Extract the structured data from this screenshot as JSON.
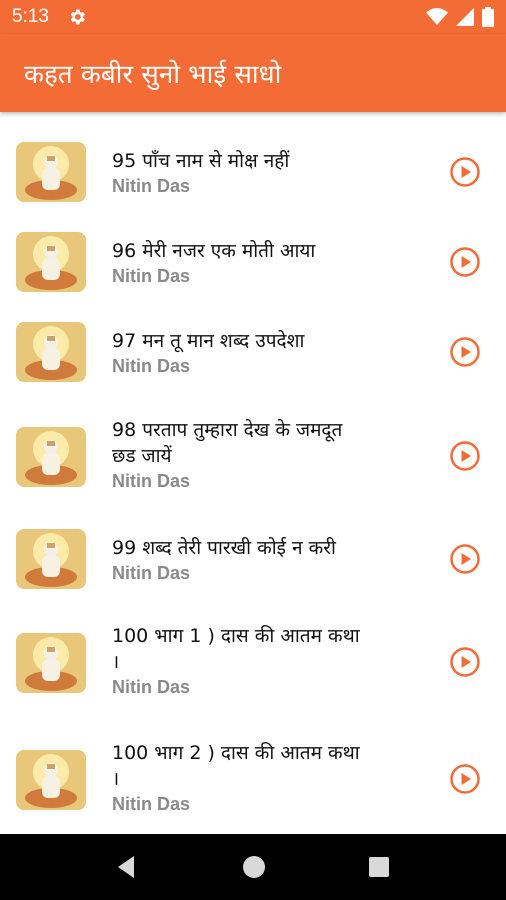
{
  "status_bar": {
    "time": "5:13",
    "icons": [
      "gear-icon",
      "wifi-icon",
      "cellular-icon",
      "battery-icon"
    ]
  },
  "app_bar": {
    "title": "कहत कबीर सुनो भाई साधो",
    "color": "#f36b35"
  },
  "songs": [
    {
      "title_lines": [
        "95 पाँच नाम से मोक्ष नहीं"
      ],
      "artist": "Nitin Das"
    },
    {
      "title_lines": [
        "96 मेरी नजर एक मोती आया"
      ],
      "artist": "Nitin Das"
    },
    {
      "title_lines": [
        "97 मन तू मान शब्द उपदेशा"
      ],
      "artist": "Nitin Das"
    },
    {
      "title_lines": [
        "98 परताप तुम्हारा देख के जमदूत",
        "छड जायें"
      ],
      "artist": "Nitin Das"
    },
    {
      "title_lines": [
        "99 शब्द तेरी पारखी कोई  न करी"
      ],
      "artist": "Nitin Das"
    },
    {
      "title_lines": [
        "100 भाग 1 ) दास की आतम कथा",
        "।"
      ],
      "artist": "Nitin Das"
    },
    {
      "title_lines": [
        "100 भाग 2 ) दास की आतम कथा",
        "।"
      ],
      "artist": "Nitin Das"
    }
  ],
  "icons": {
    "play": "play-circle-icon",
    "thumbnail": "saint-thumbnail"
  },
  "nav_bar": {
    "icons": [
      "back-icon",
      "home-icon",
      "recents-icon"
    ]
  }
}
